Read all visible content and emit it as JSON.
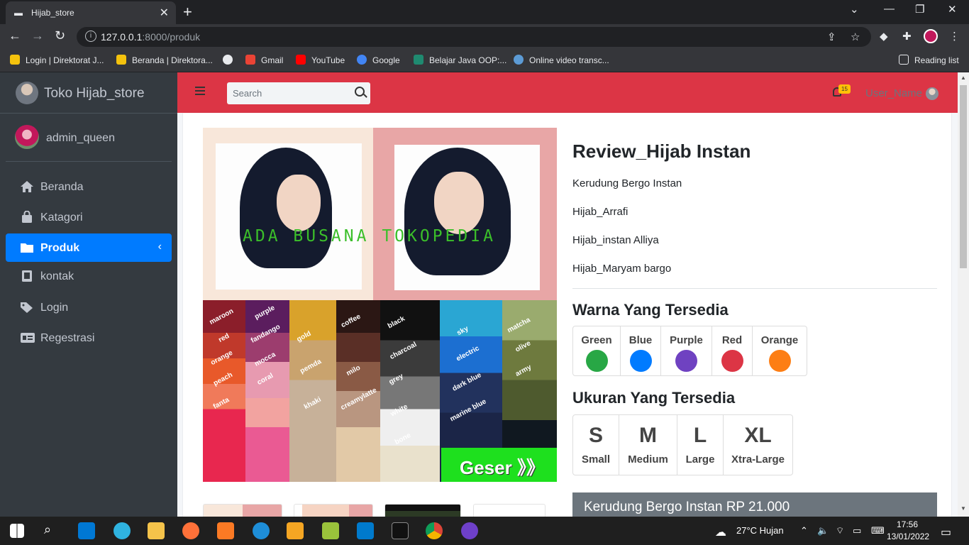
{
  "browser": {
    "tab_title": "Hijab_store",
    "url_host": "127.0.0.1",
    "url_rest": ":8000/produk",
    "bookmarks": [
      "Login | Direktorat J...",
      "Beranda | Direktora...",
      "Gmail",
      "YouTube",
      "Google",
      "Belajar Java OOP:...",
      "Online video transc...",
      "Reading list"
    ]
  },
  "sidebar": {
    "brand": "Toko Hijab_store",
    "user": "admin_queen",
    "items": [
      {
        "label": "Beranda",
        "icon": "home-icon"
      },
      {
        "label": "Katagori",
        "icon": "shopping-bag-icon"
      },
      {
        "label": "Produk",
        "icon": "folder-icon"
      },
      {
        "label": "kontak",
        "icon": "address-book-icon"
      },
      {
        "label": "Login",
        "icon": "tags-icon"
      },
      {
        "label": "Regestrasi",
        "icon": "id-card-icon"
      }
    ],
    "active_index": 2
  },
  "header": {
    "search_placeholder": "Search",
    "notif_count": "15",
    "user_name": "User_Name"
  },
  "product": {
    "image_watermark": "ADA BUSANA TOKOPEDIA",
    "image_button": "Geser 》》",
    "fabric_labels": [
      "maroon",
      "purple",
      "black",
      "sky",
      "matcha",
      "red",
      "fandango",
      "coffee",
      "olive",
      "charcoal",
      "electric",
      "orange",
      "gold",
      "mocca",
      "army",
      "peach",
      "coral",
      "pemda",
      "milo",
      "grey",
      "dark blue",
      "fanta",
      "khaki",
      "creamylatte",
      "white",
      "marine blue",
      "bone"
    ],
    "title": "Review_Hijab Instan",
    "list": [
      "Kerudung Bergo Instan",
      "Hijab_Arrafi",
      "Hijab_instan Alliya",
      "Hijab_Maryam bargo"
    ],
    "colors_heading": "Warna Yang Tersedia",
    "colors": [
      {
        "name": "Green",
        "hex": "#28a745"
      },
      {
        "name": "Blue",
        "hex": "#007bff"
      },
      {
        "name": "Purple",
        "hex": "#6f42c1"
      },
      {
        "name": "Red",
        "hex": "#dc3545"
      },
      {
        "name": "Orange",
        "hex": "#fd7e14"
      }
    ],
    "sizes_heading": "Ukuran Yang Tersedia",
    "sizes": [
      {
        "code": "S",
        "label": "Small"
      },
      {
        "code": "M",
        "label": "Medium"
      },
      {
        "code": "L",
        "label": "Large"
      },
      {
        "code": "XL",
        "label": "Xtra-Large"
      }
    ],
    "price": "Kerudung Bergo Instan RP 21.000"
  },
  "taskbar": {
    "weather": "27°C  Hujan",
    "time": "17:56",
    "date": "13/01/2022"
  },
  "theme": {
    "header_red": "#dc3545",
    "sidebar_dark": "#343a40",
    "active_blue": "#007bff"
  }
}
